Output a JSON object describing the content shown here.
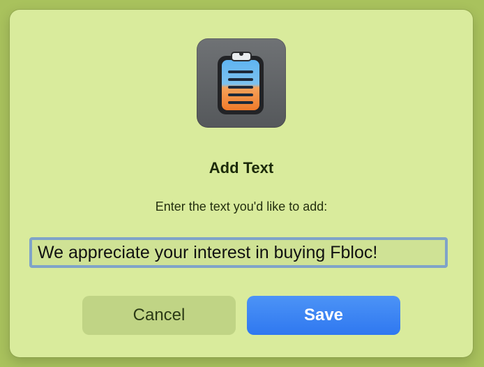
{
  "dialog": {
    "title": "Add Text",
    "prompt": "Enter the text you'd like to add:",
    "input": {
      "value": "We appreciate your interest in buying Fbloc!"
    },
    "buttons": {
      "cancel_label": "Cancel",
      "save_label": "Save"
    }
  },
  "icons": {
    "app_icon": "clipboard-icon"
  },
  "colors": {
    "background": "#a9c25d",
    "dialog": "#d9eb9c",
    "accent": "#2f78f0",
    "input_border": "#7fa3c8"
  }
}
